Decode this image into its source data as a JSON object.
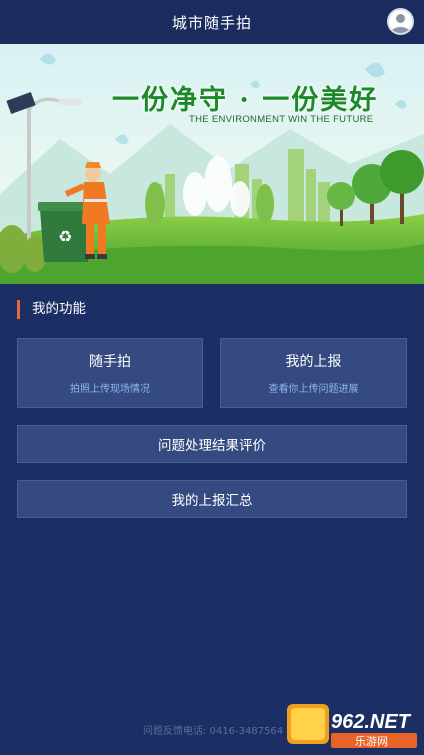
{
  "header": {
    "title": "城市随手拍",
    "avatar_icon": "user-avatar-icon"
  },
  "banner": {
    "slogan": "一份净守 · 一份美好",
    "subslogan": "THE ENVIRONMENT WIN THE FUTURE"
  },
  "section": {
    "title": "我的功能"
  },
  "cards": {
    "snap": {
      "title": "随手拍",
      "subtitle": "拍照上传现场情况"
    },
    "my_report": {
      "title": "我的上报",
      "subtitle": "查看你上传问题进展"
    },
    "evaluation": {
      "title": "问题处理结果评价"
    },
    "summary": {
      "title": "我的上报汇总"
    }
  },
  "footer": {
    "feedback": "问题反馈电话: 0416-3487564"
  },
  "watermark": {
    "brand": "962.NET",
    "sub": "乐游网"
  },
  "colors": {
    "background": "#1c2f64",
    "card": "#354a81",
    "accent": "#e06b3a",
    "subtitle": "#8fb5f0"
  }
}
